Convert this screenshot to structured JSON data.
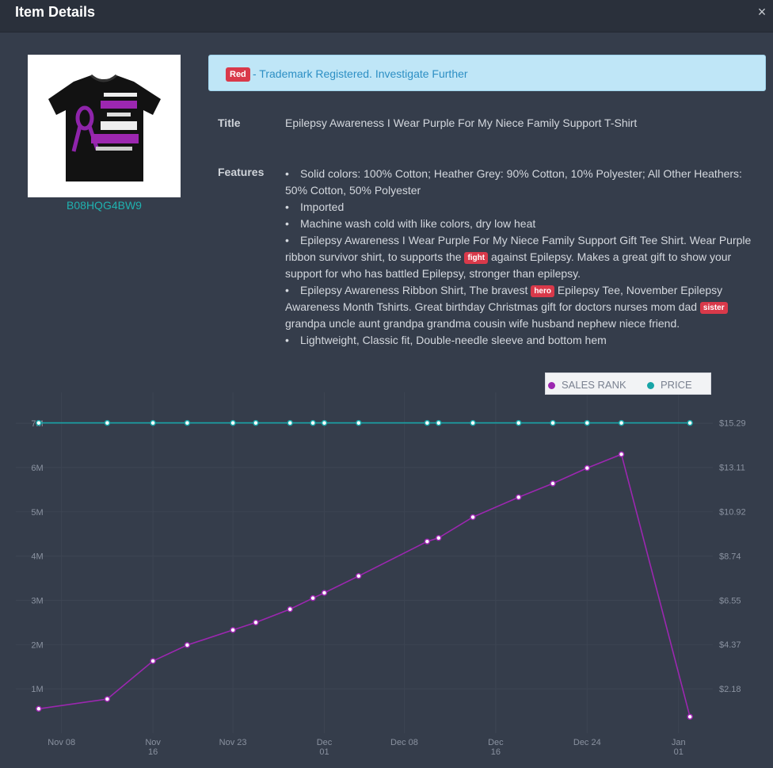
{
  "header": {
    "title": "Item Details",
    "close_glyph": "×"
  },
  "product": {
    "asin": "B08HQG4BW9",
    "image_icon": "tshirt-image"
  },
  "alert": {
    "badge": "Red",
    "message": "- Trademark Registered. Investigate Further"
  },
  "details": {
    "title_label": "Title",
    "title_value": "Epilepsy Awareness I Wear Purple For My Niece Family Support T-Shirt",
    "features_label": "Features",
    "features": [
      {
        "parts": [
          "Solid colors: 100% Cotton; Heather Grey: 90% Cotton, 10% Polyester; All Other Heathers: 50% Cotton, 50% Polyester"
        ]
      },
      {
        "parts": [
          "Imported"
        ]
      },
      {
        "parts": [
          "Machine wash cold with like colors, dry low heat"
        ]
      },
      {
        "parts": [
          "Epilepsy Awareness I Wear Purple For My Niece Family Support Gift Tee Shirt. Wear Purple ribbon survivor shirt, to supports the ",
          {
            "tag": "fight"
          },
          " against Epilepsy. Makes a great gift to show your support for who has battled Epilepsy, stronger than epilepsy."
        ]
      },
      {
        "parts": [
          "Epilepsy Awareness Ribbon Shirt, The bravest ",
          {
            "tag": "hero"
          },
          " Epilepsy Tee, November Epilepsy Awareness Month Tshirts. Great birthday Christmas gift for doctors nurses mom dad ",
          {
            "tag": "sister"
          },
          " grandpa uncle aunt grandpa grandma cousin wife husband nephew niece friend."
        ]
      },
      {
        "parts": [
          "Lightweight, Classic fit, Double-needle sleeve and bottom hem"
        ]
      }
    ]
  },
  "colors": {
    "sales_rank": "#9c27b0",
    "price": "#18a5a7",
    "tag_red": "#d9394a"
  },
  "chart_data": {
    "type": "line",
    "x_ticks": [
      {
        "date": "2020-11-08",
        "label": [
          "Nov 08"
        ]
      },
      {
        "date": "2020-11-16",
        "label": [
          "Nov",
          "16"
        ]
      },
      {
        "date": "2020-11-23",
        "label": [
          "Nov 23"
        ]
      },
      {
        "date": "2020-12-01",
        "label": [
          "Dec",
          "01"
        ]
      },
      {
        "date": "2020-12-08",
        "label": [
          "Dec 08"
        ]
      },
      {
        "date": "2020-12-16",
        "label": [
          "Dec",
          "16"
        ]
      },
      {
        "date": "2020-12-24",
        "label": [
          "Dec 24"
        ]
      },
      {
        "date": "2021-01-01",
        "label": [
          "Jan",
          "01"
        ]
      }
    ],
    "y_left": {
      "ticks": [
        "1M",
        "2M",
        "3M",
        "4M",
        "5M",
        "6M",
        "7M"
      ],
      "range": [
        0,
        7700000
      ]
    },
    "y_right": {
      "ticks": [
        "$2.18",
        "$4.37",
        "$6.55",
        "$8.74",
        "$10.92",
        "$13.11",
        "$15.29"
      ],
      "range": [
        0,
        16.8
      ]
    },
    "legend": {
      "position": "top-right",
      "items": [
        "SALES RANK",
        "PRICE"
      ]
    },
    "series": [
      {
        "name": "SALES RANK",
        "axis": "left",
        "x": [
          "2020-11-06",
          "2020-11-12",
          "2020-11-16",
          "2020-11-19",
          "2020-11-23",
          "2020-11-25",
          "2020-11-28",
          "2020-11-30",
          "2020-12-01",
          "2020-12-04",
          "2020-12-10",
          "2020-12-11",
          "2020-12-14",
          "2020-12-18",
          "2020-12-21",
          "2020-12-24",
          "2020-12-27",
          "2021-01-02"
        ],
        "values": [
          550000,
          770000,
          1630000,
          1990000,
          2330000,
          2500000,
          2800000,
          3050000,
          3170000,
          3550000,
          4330000,
          4410000,
          4880000,
          5330000,
          5640000,
          5990000,
          6300000,
          370000
        ]
      },
      {
        "name": "PRICE",
        "axis": "right",
        "x": [
          "2020-11-06",
          "2020-11-12",
          "2020-11-16",
          "2020-11-19",
          "2020-11-23",
          "2020-11-25",
          "2020-11-28",
          "2020-11-30",
          "2020-12-01",
          "2020-12-04",
          "2020-12-10",
          "2020-12-11",
          "2020-12-14",
          "2020-12-18",
          "2020-12-21",
          "2020-12-24",
          "2020-12-27",
          "2021-01-02"
        ],
        "values": [
          15.29,
          15.29,
          15.29,
          15.29,
          15.29,
          15.29,
          15.29,
          15.29,
          15.29,
          15.29,
          15.29,
          15.29,
          15.29,
          15.29,
          15.29,
          15.29,
          15.29,
          15.29
        ]
      }
    ],
    "grid": true
  }
}
